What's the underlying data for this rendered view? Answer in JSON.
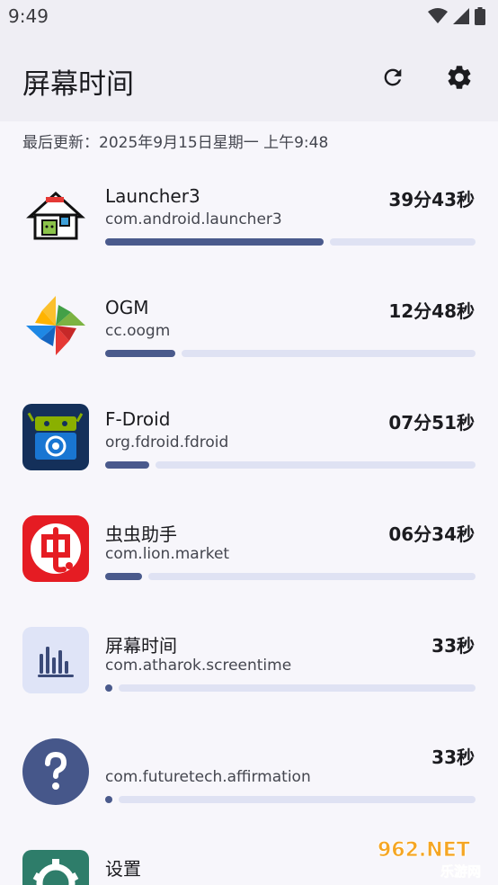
{
  "status": {
    "time": "9:49"
  },
  "appbar": {
    "title": "屏幕时间",
    "refresh_icon": "refresh-icon",
    "settings_icon": "gear-icon"
  },
  "updated": "最后更新：2025年9月15日星期一 上午9:48",
  "apps": [
    {
      "name": "Launcher3",
      "package": "com.android.launcher3",
      "time": "39分43秒",
      "progress": 0.59,
      "icon": "launcher3-house-icon"
    },
    {
      "name": "OGM",
      "package": "cc.oogm",
      "time": "12分48秒",
      "progress": 0.19,
      "icon": "ogm-pinwheel-icon"
    },
    {
      "name": "F-Droid",
      "package": "org.fdroid.fdroid",
      "time": "07分51秒",
      "progress": 0.12,
      "icon": "fdroid-robot-icon"
    },
    {
      "name": "虫虫助手",
      "package": "com.lion.market",
      "time": "06分34秒",
      "progress": 0.1,
      "icon": "chongchong-icon"
    },
    {
      "name": "屏幕时间",
      "package": "com.atharok.screentime",
      "time": "33秒",
      "progress": 0.01,
      "icon": "bar-chart-icon"
    },
    {
      "name": "",
      "package": "com.futuretech.affirmation",
      "time": "33秒",
      "progress": 0.01,
      "icon": "question-mark-icon"
    },
    {
      "name": "设置",
      "package": "",
      "time": "",
      "progress": 0,
      "icon": "settings-gear-app-icon"
    }
  ],
  "watermark": {
    "text": "962.NET",
    "subtext": "乐游网"
  }
}
